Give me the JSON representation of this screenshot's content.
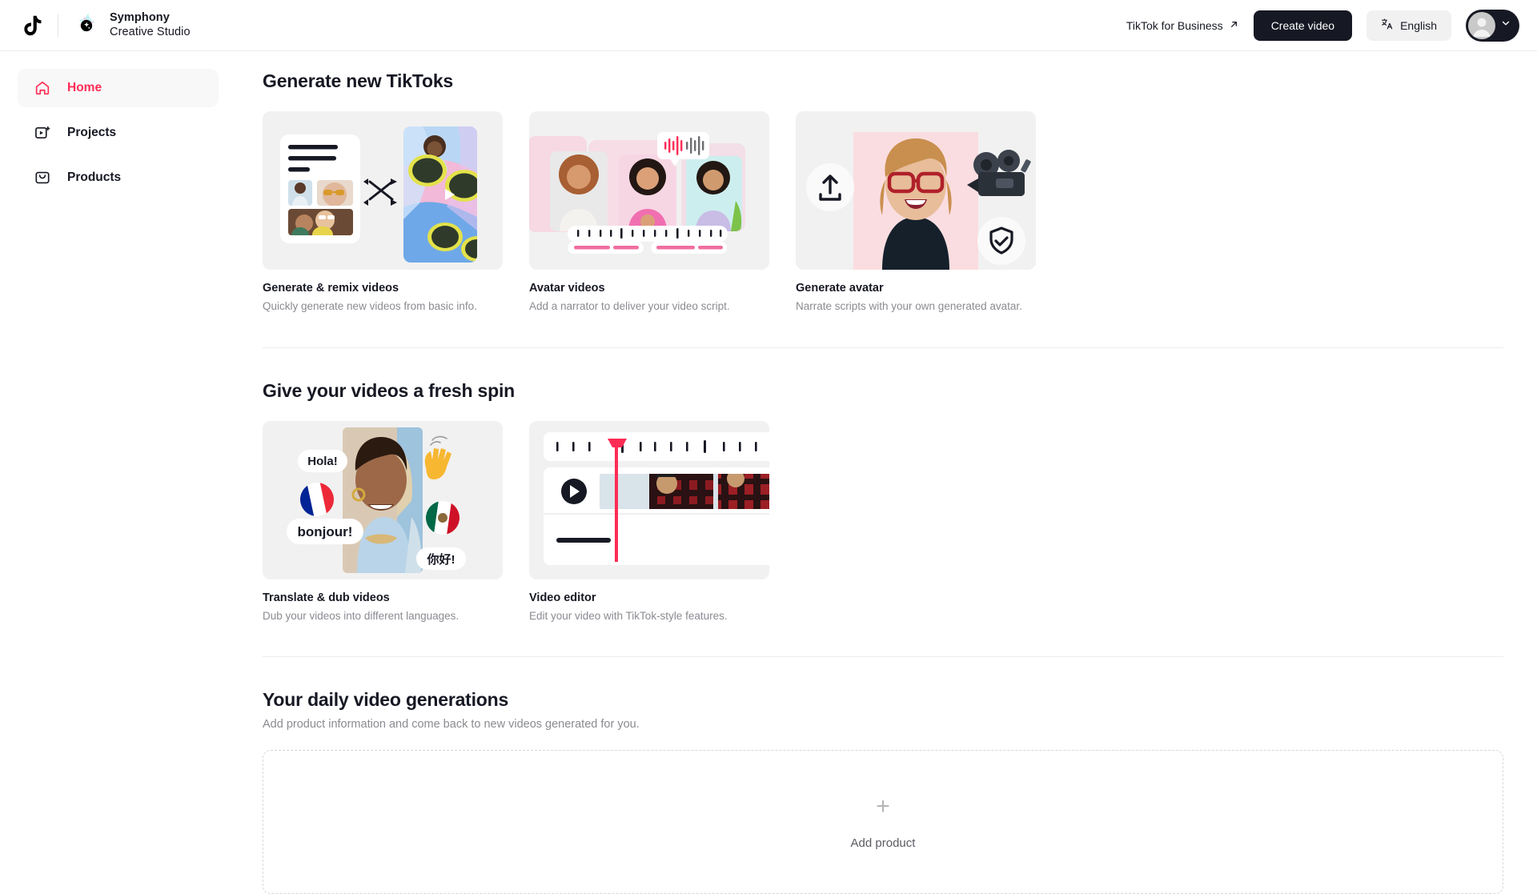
{
  "header": {
    "brand_line1": "Symphony",
    "brand_line2": "Creative Studio",
    "business_link": "TikTok for Business",
    "create_button": "Create video",
    "language": "English",
    "icons": {
      "tiktok_logo": "tiktok-note-icon",
      "symphony_logo": "symphony-star-icon",
      "external_link": "external-link-arrow-icon",
      "translate": "translate-icon",
      "avatar": "user-avatar-icon",
      "chevron": "chevron-down-icon"
    }
  },
  "sidebar": {
    "items": [
      {
        "label": "Home",
        "icon": "home-icon",
        "active": true
      },
      {
        "label": "Projects",
        "icon": "video-plus-icon",
        "active": false
      },
      {
        "label": "Products",
        "icon": "bag-icon",
        "active": false
      }
    ],
    "active_color": "#fe2c55"
  },
  "sections": [
    {
      "title": "Generate new TikToks",
      "cards": [
        {
          "title": "Generate & remix videos",
          "desc": "Quickly generate new videos from basic info.",
          "thumb": "document-with-photos-and-shuffle-to-video"
        },
        {
          "title": "Avatar videos",
          "desc": "Add a narrator to deliver your video script.",
          "thumb": "three-presenter-portraits-with-waveform-bubble"
        },
        {
          "title": "Generate avatar",
          "desc": "Narrate scripts with your own generated avatar.",
          "thumb": "laughing-woman-with-upload-camera-and-shield-badges"
        }
      ]
    },
    {
      "title": "Give your videos a fresh spin",
      "cards": [
        {
          "title": "Translate & dub videos",
          "desc": "Dub your videos into different languages.",
          "thumb": "woman-selfie-with-language-bubbles-and-flags",
          "bubbles": [
            "Hola!",
            "bonjour!",
            "你好!"
          ],
          "flags": [
            "france-flag-icon",
            "mexico-flag-icon"
          ],
          "emoji": "👋"
        },
        {
          "title": "Video editor",
          "desc": "Edit your video with TikTok-style features.",
          "thumb": "timeline-with-playhead-play-button-and-clip"
        }
      ]
    }
  ],
  "daily": {
    "title": "Your daily video generations",
    "subtitle": "Add product information and come back to new videos generated for you.",
    "add_product_label": "Add product",
    "plus_glyph": "+"
  },
  "colors": {
    "accent_pink": "#fe2c55",
    "text_primary": "#161823",
    "text_muted": "#8a8b91",
    "surface": "#f1f1f2"
  }
}
